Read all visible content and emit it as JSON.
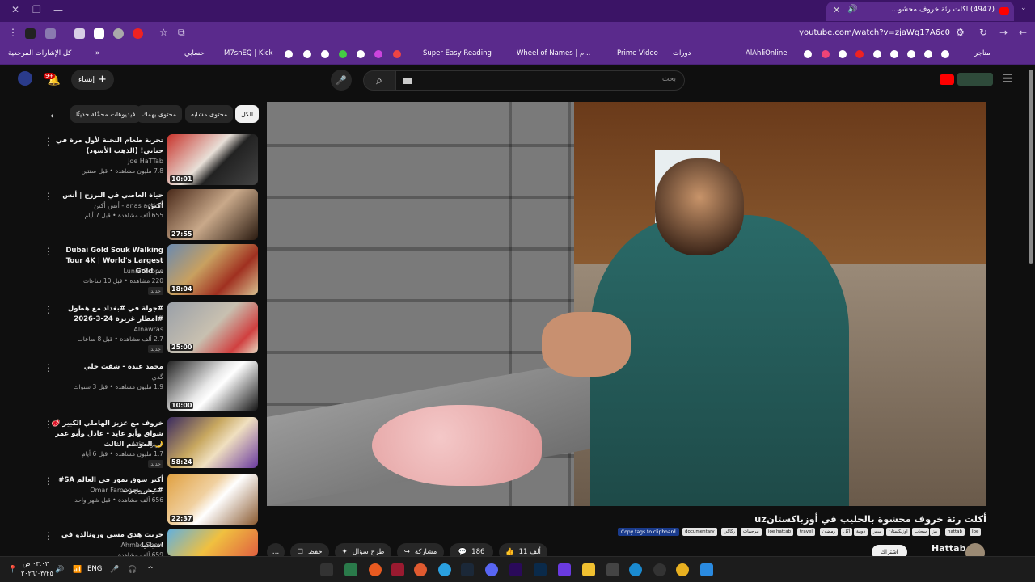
{
  "browser": {
    "tab_title": "(4947) أكلت رئة خروف محشو...",
    "url": "youtube.com/watch?v=zjaWg17A6c0",
    "bookmarks_left": "كل الإشارات المرجعية",
    "bookmarks": [
      "حسابي",
      "M7snEQ | Kick",
      "Super Easy Reading",
      "Wheel of Names | م...",
      "Prime Video",
      "دورات",
      "AlAhliOnline",
      "متاجر"
    ]
  },
  "masthead": {
    "search_placeholder": "بحث",
    "create_label": "إنشاء",
    "notif_count": "9+"
  },
  "chips": [
    "الكل",
    "محتوى مشابه",
    "محتوى يهمك",
    "فيديوهات محمَّلة حديثًا"
  ],
  "recs": [
    {
      "title": "تجربة طعام النخبة لأول مرة في حياتي! (الذهب الأسود)",
      "channel": "Joe HaTTab",
      "meta": "7.8 مليون مشاهدة • قبل سنتين",
      "dur": "10:01",
      "new": ""
    },
    {
      "title": "حياة العاصي في البرزخ | أنس أكتن",
      "channel": "anas action - أنس أكتن",
      "meta": "655 ألف مشاهدة • قبل 7 أيام",
      "dur": "27:55",
      "new": ""
    },
    {
      "title": "Dubai Gold Souk Walking Tour 4K | World's Largest Gold ...",
      "channel": "Lunar Scope",
      "meta": "220 مشاهدة • قبل 10 ساعات",
      "dur": "18:04",
      "new": "جديد"
    },
    {
      "title": "#جولة في #بغداد مع هطول #امطار غزيرة 24-3-2026",
      "channel": "Alnawras",
      "meta": "2.7 ألف مشاهدة • قبل 8 ساعات",
      "dur": "25:00",
      "new": "جديد"
    },
    {
      "title": "محمد عبده - شفت خلي",
      "channel": "گذي",
      "meta": "1.9 مليون مشاهدة • قبل 3 سنوات",
      "dur": "10:00",
      "new": ""
    },
    {
      "title": "خروف مع عزيز الهاملي الكبير 🥩 شواق وأبو عايد - عادل وأبو عمر 🌙 الموسم الثالث",
      "channel": "عزيز - Aziz",
      "meta": "1.7 مليون مشاهدة • قبل 6 أيام",
      "dur": "58:24",
      "new": "جديد"
    },
    {
      "title": "أكبر سوق تمور في العالم SA# #عمر_يجرب",
      "channel": "عمر فاروق Omar Farooq",
      "meta": "656 ألف مشاهدة • قبل شهر واحد",
      "dur": "22:37",
      "new": ""
    },
    {
      "title": "جربت هدي مسي ورونالدو في اسبانيا !",
      "channel": "Ahmed Show",
      "meta": "659 ألف مشاهدة",
      "dur": "",
      "new": ""
    }
  ],
  "video": {
    "title": "أكلت رئة خروف محشوة بالحليب في أوزباكستانuz",
    "copy_tags": "Copy tags to clipboard",
    "tags": [
      "documentary",
      "ركاكي",
      "بيرحمات",
      "joe hattab",
      "travel",
      "رمضان",
      "أكل",
      "دومة",
      "سفر",
      "اوزبكستان",
      "سحاب",
      "بيز",
      "hattab",
      "Joe"
    ],
    "channel": "Hattab",
    "subscribe": "اشتراك",
    "likes": "11 ألف",
    "comments": "186",
    "share": "مشاركة",
    "ask": "طرح سؤال",
    "save": "حفظ"
  },
  "taskbar": {
    "time": "٠٣:٠٣ ص",
    "date": "٢٠٢٦/٠٣/٢٥",
    "lang": "ENG"
  }
}
